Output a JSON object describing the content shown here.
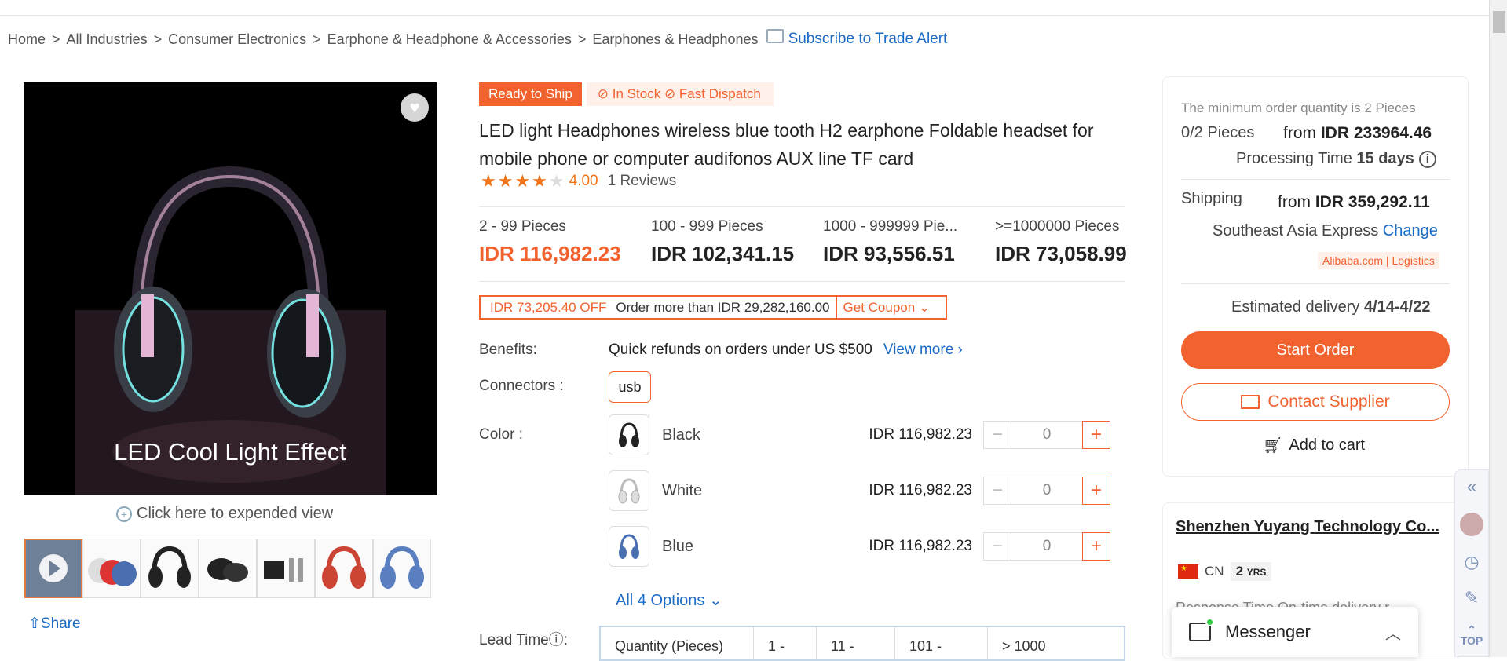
{
  "breadcrumb": [
    "Home",
    "All Industries",
    "Consumer Electronics",
    "Earphone & Headphone & Accessories",
    "Earphones & Headphones"
  ],
  "breadcrumb_sep": ">",
  "subscribe_label": "Subscribe to Trade Alert",
  "gallery": {
    "overlay_text": "LED Cool Light Effect",
    "expand_label": "Click here to expended view",
    "share_label": "Share",
    "thumb_count": 7
  },
  "product": {
    "badge_ready": "Ready to Ship",
    "badge_stock": "In Stock",
    "badge_dispatch": "Fast Dispatch",
    "title": "LED light Headphones wireless blue tooth H2 earphone Foldable headset for mobile phone or computer audifonos AUX line TF card",
    "rating_value": "4.00",
    "stars_filled": 4,
    "reviews": "1 Reviews"
  },
  "tiers": [
    {
      "qty": "2 - 99 Pieces",
      "price": "IDR 116,982.23"
    },
    {
      "qty": "100 - 999 Pieces",
      "price": "IDR 102,341.15"
    },
    {
      "qty": "1000 - 999999 Pie...",
      "price": "IDR 93,556.51"
    },
    {
      "qty": ">=1000000 Pieces",
      "price": "IDR 73,058.99"
    }
  ],
  "coupon": {
    "off": "IDR 73,205.40 OFF",
    "min": "Order more than IDR 29,282,160.00",
    "get": "Get Coupon"
  },
  "benefits": {
    "label": "Benefits:",
    "text": "Quick refunds on orders under US $500",
    "more": "View more"
  },
  "connectors": {
    "label": "Connectors :",
    "value": "usb"
  },
  "colors": {
    "label": "Color :",
    "items": [
      {
        "name": "Black",
        "price": "IDR 116,982.23",
        "qty": "0"
      },
      {
        "name": "White",
        "price": "IDR 116,982.23",
        "qty": "0"
      },
      {
        "name": "Blue",
        "price": "IDR 116,982.23",
        "qty": "0"
      }
    ],
    "all_options": "All 4 Options"
  },
  "lead_time": {
    "label": "Lead Time",
    "cols": [
      "Quantity (Pieces)",
      "1 -",
      "11 -",
      "101 -",
      "> 1000"
    ]
  },
  "order": {
    "min_qty": "The minimum order quantity is 2 Pieces",
    "pcs": "0/2 Pieces",
    "from_label": "from",
    "from_price": "IDR 233964.46",
    "processing_label": "Processing Time",
    "processing_value": "15 days",
    "shipping_label": "Shipping",
    "shipping_price": "IDR 359,292.11",
    "shipping_method": "Southeast Asia Express",
    "change": "Change",
    "logistics": "Alibaba.com | Logistics",
    "est_label": "Estimated delivery",
    "est_value": "4/14-4/22",
    "start": "Start Order",
    "contact": "Contact Supplier",
    "cart": "Add to cart"
  },
  "supplier": {
    "name": "Shenzhen Yuyang Technology Co...",
    "country": "CN",
    "years": "2",
    "years_unit": "YRS",
    "subline": "Response Time  On-time delivery r..."
  },
  "messenger": "Messenger",
  "sidebar_top": "TOP",
  "colors_theme": {
    "accent": "#f1622e",
    "link": "#1a6bc6"
  }
}
